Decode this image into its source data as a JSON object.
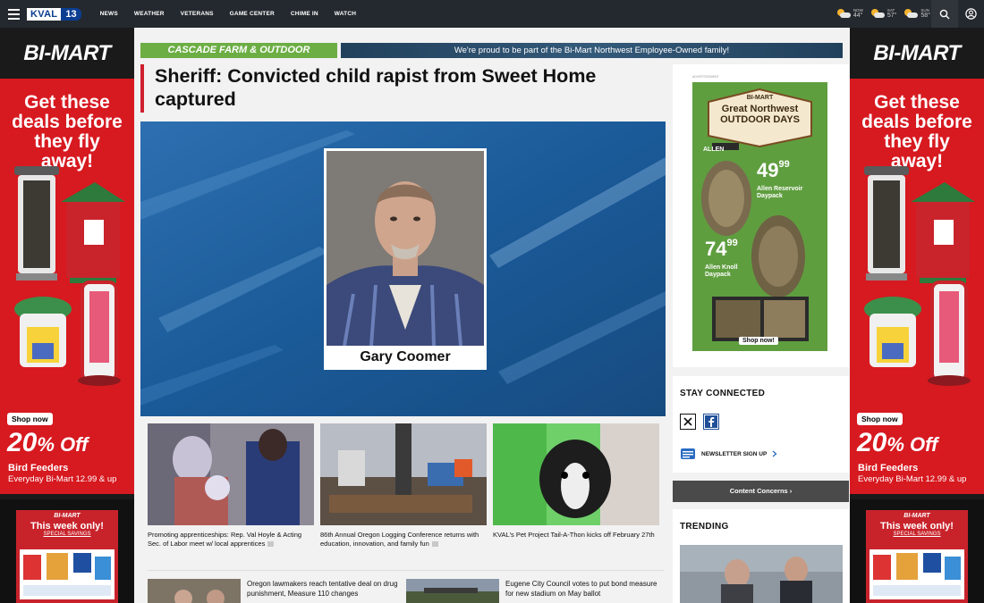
{
  "nav": {
    "logo_text": "KVAL",
    "logo_number": "13",
    "items": [
      "NEWS",
      "WEATHER",
      "VETERANS",
      "GAME CENTER",
      "CHIME IN",
      "WATCH"
    ],
    "weather": [
      {
        "day": "NOW",
        "temp": "44°"
      },
      {
        "day": "SAT",
        "temp": "57°"
      },
      {
        "day": "SUN",
        "temp": "58°"
      }
    ]
  },
  "rail": {
    "brand": "BI-MART",
    "headline": "Get these deals before they fly away!",
    "shop_now": "Shop now",
    "percent": "20",
    "percent_suffix": "% Off",
    "product": "Bird Feeders",
    "subline": "Everyday Bi-Mart 12.99 & up",
    "ad2_logo": "BI-MART",
    "ad2_title": "This week only!",
    "ad2_sub": "SPECIAL SAVINGS"
  },
  "banner": {
    "left_text": "CASCADE FARM & OUTDOOR",
    "right_text": "We're proud to be part of the Bi-Mart Northwest Employee-Owned family!"
  },
  "article": {
    "headline": "Sheriff: Convicted child rapist from Sweet Home captured",
    "mugshot_name": "Gary Coomer"
  },
  "stories": [
    {
      "title": "Promoting apprenticeships: Rep. Val Hoyle & Acting Sec. of Labor meet w/ local apprentices"
    },
    {
      "title": "86th Annual Oregon Logging Conference returns with education, innovation, and family fun"
    },
    {
      "title": "KVAL's Pet Project Tail-A-Thon kicks off February 27th"
    }
  ],
  "mini_stories": [
    {
      "title": "Oregon lawmakers reach tentative deal on drug punishment, Measure 110 changes"
    },
    {
      "title": "Eugene City Council votes to put bond measure for new stadium on May ballot"
    }
  ],
  "side_ad": {
    "label": "ADVERTISEMENT",
    "brand": "BI-MART",
    "title": "Great Northwest OUTDOOR DAYS",
    "allen": "ALLEN",
    "price1": "49",
    "price1_cents": "99",
    "item1": "Allen Reservoir Daypack",
    "price2": "74",
    "price2_cents": "99",
    "item2": "Allen Knoll Daypack",
    "shop": "Shop now!"
  },
  "stay_connected": {
    "title": "STAY CONNECTED",
    "newsletter": "NEWSLETTER SIGN UP"
  },
  "content_concerns": "Content Concerns ›",
  "trending": {
    "title": "TRENDING"
  }
}
